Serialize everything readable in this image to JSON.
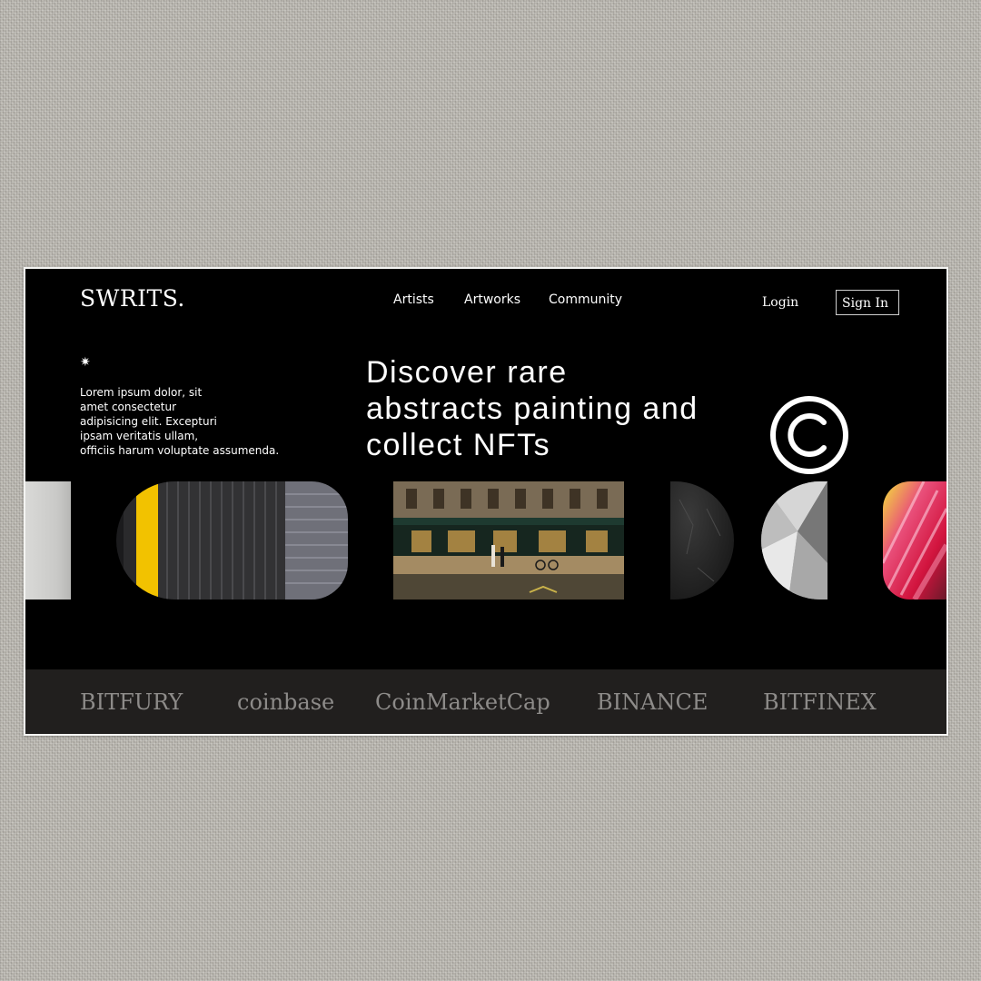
{
  "header": {
    "logo": "SWRITS.",
    "nav": [
      "Artists",
      "Artworks",
      "Community"
    ],
    "login_label": "Login",
    "signin_label": "Sign In"
  },
  "hero": {
    "star_glyph": "✷",
    "intro_lines": [
      "Lorem ipsum dolor, sit",
      "amet consectetur",
      "adipisicing elit. Excepturi",
      "ipsam veritatis ullam,",
      "officiis harum voluptate assumenda."
    ],
    "headline_lines": [
      "Discover rare",
      "abstracts painting and",
      "collect NFTs"
    ],
    "icon": "copyright-icon"
  },
  "gallery": {
    "tiles": [
      {
        "name": "gallery-tile-white-wall"
      },
      {
        "name": "gallery-tile-yellow-stripe"
      },
      {
        "name": "gallery-tile-paris-street"
      },
      {
        "name": "gallery-tile-dark-stone"
      },
      {
        "name": "gallery-tile-gray-geometric"
      },
      {
        "name": "gallery-tile-pink-abstract"
      }
    ]
  },
  "partners": [
    "BITFURY",
    "coinbase",
    "CoinMarketCap",
    "BINANCE",
    "BITFINEX"
  ],
  "colors": {
    "background": "#000000",
    "text": "#ffffff",
    "partner_bar": "#211f1e",
    "partner_text": "#8d8b89",
    "accent_yellow": "#f2c200"
  }
}
